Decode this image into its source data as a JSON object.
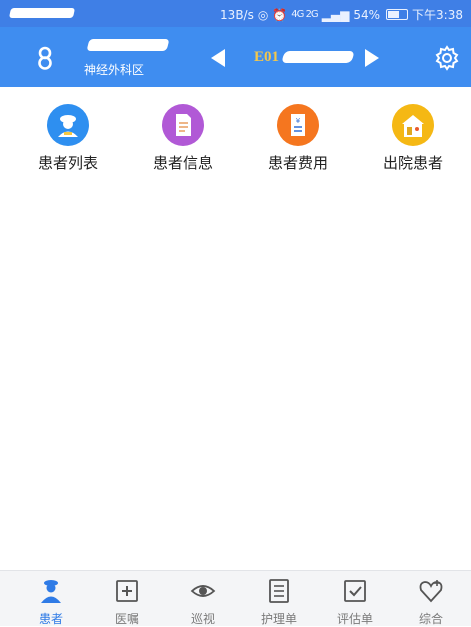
{
  "status_bar": {
    "speed": "13B/s",
    "signal_text": "4G 2G",
    "battery": "54%",
    "time": "下午3:38"
  },
  "header": {
    "ward": "神经外科区",
    "bed_prefix": "E01"
  },
  "menu": [
    {
      "label": "患者列表",
      "icon": "patient-list-icon",
      "color": "#2e8ff0"
    },
    {
      "label": "患者信息",
      "icon": "patient-info-icon",
      "color": "#b159d6"
    },
    {
      "label": "患者费用",
      "icon": "patient-fee-icon",
      "color": "#f5761f"
    },
    {
      "label": "出院患者",
      "icon": "discharged-icon",
      "color": "#f5b814"
    }
  ],
  "bottom_nav": [
    {
      "label": "患者",
      "icon": "nurse-icon",
      "active": true
    },
    {
      "label": "医嘱",
      "icon": "medical-order-icon",
      "active": false
    },
    {
      "label": "巡视",
      "icon": "eye-icon",
      "active": false
    },
    {
      "label": "护理单",
      "icon": "nursing-sheet-icon",
      "active": false
    },
    {
      "label": "评估单",
      "icon": "assessment-icon",
      "active": false
    },
    {
      "label": "综合",
      "icon": "heart-plus-icon",
      "active": false
    }
  ],
  "colors": {
    "header": "#3f8df0",
    "status_bar": "#3f7fe6",
    "active": "#2f7be6"
  }
}
